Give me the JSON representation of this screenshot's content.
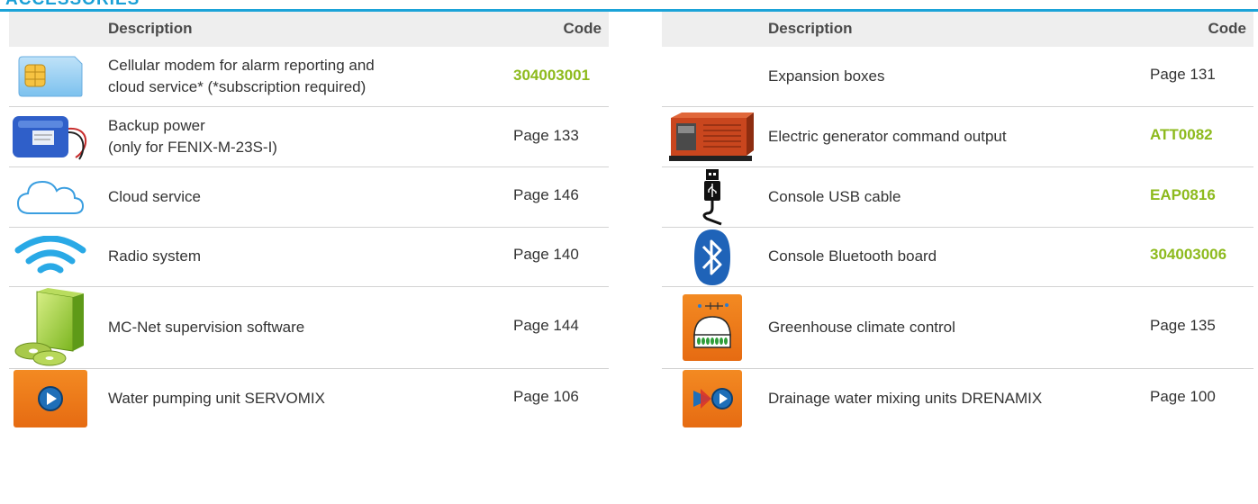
{
  "section_title": "Accessories",
  "columns": {
    "description": "Description",
    "code": "Code"
  },
  "left_rows": [
    {
      "icon": "sim-card-icon",
      "lines": [
        "Cellular modem for alarm reporting and",
        "cloud service* (*subscription required)"
      ],
      "code": "304003001",
      "code_is_product": true
    },
    {
      "icon": "battery-pack-icon",
      "lines": [
        "Backup power",
        "(only for FENIX-M-23S-I)"
      ],
      "code": "Page 133",
      "code_is_product": false
    },
    {
      "icon": "cloud-icon",
      "lines": [
        "Cloud service"
      ],
      "code": "Page 146",
      "code_is_product": false
    },
    {
      "icon": "wifi-icon",
      "lines": [
        "Radio system"
      ],
      "code": "Page 140",
      "code_is_product": false
    },
    {
      "icon": "software-box-icon",
      "lines": [
        "MC-Net supervision software"
      ],
      "code": "Page 144",
      "code_is_product": false
    },
    {
      "icon": "pump-unit-icon",
      "lines": [
        "Water pumping unit SERVOMIX"
      ],
      "code": "Page 106",
      "code_is_product": false
    }
  ],
  "right_rows": [
    {
      "icon": "",
      "lines": [
        "Expansion boxes"
      ],
      "code": "Page 131",
      "code_is_product": false
    },
    {
      "icon": "generator-icon",
      "lines": [
        "Electric generator command output"
      ],
      "code": "ATT0082",
      "code_is_product": true
    },
    {
      "icon": "usb-cable-icon",
      "lines": [
        "Console USB cable"
      ],
      "code": "EAP0816",
      "code_is_product": true
    },
    {
      "icon": "bluetooth-icon",
      "lines": [
        "Console Bluetooth board"
      ],
      "code": "304003006",
      "code_is_product": true
    },
    {
      "icon": "greenhouse-icon",
      "lines": [
        "Greenhouse climate control"
      ],
      "code": "Page 135",
      "code_is_product": false
    },
    {
      "icon": "mixing-unit-icon",
      "lines": [
        "Drainage water mixing units DRENAMIX"
      ],
      "code": "Page 100",
      "code_is_product": false
    }
  ],
  "colors": {
    "accent_blue": "#1ba3d8",
    "code_green": "#8dba1d",
    "header_gray": "#eeeeee",
    "icon_orange": "#f07f1e"
  }
}
